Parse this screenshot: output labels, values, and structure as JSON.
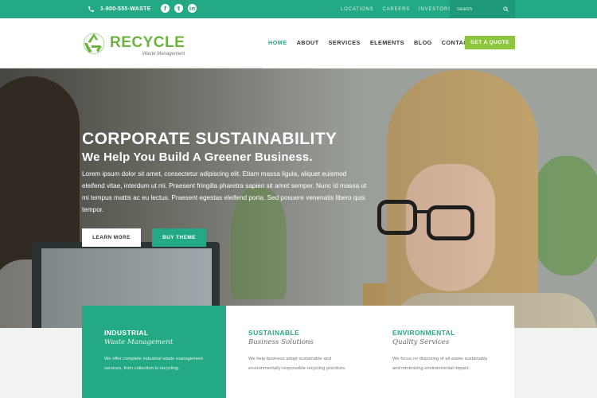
{
  "topbar": {
    "phone": "1-800-555-WASTE",
    "social": [
      "f",
      "t",
      "in"
    ],
    "links": [
      "LOCATIONS",
      "CAREERS",
      "INVESTORS"
    ],
    "search_placeholder": "Search"
  },
  "header": {
    "logo_name": "RECYCLE",
    "logo_sub": "Waste Management",
    "nav": [
      "HOME",
      "ABOUT",
      "SERVICES",
      "ELEMENTS",
      "BLOG",
      "CONTACT"
    ],
    "cta": "GET A QUOTE"
  },
  "hero": {
    "title": "CORPORATE SUSTAINABILITY",
    "subtitle": "We Help You Build A Greener Business.",
    "body": "Lorem ipsum dolor sit amet, consectetur adipiscing elit. Etiam massa ligula, aliquet euismod eleifend vitae, interdum ut mi. Praesent fringilla pharetra sapien sit amet semper. Nunc id massa ut mi tempus mattis ac eu lectus. Praesent egestas eleifend porta. Sed posuere venenatis libero quis tempor.",
    "btn_learn": "LEARN MORE",
    "btn_buy": "BUY THEME"
  },
  "features": [
    {
      "title": "INDUSTRIAL",
      "subtitle": "Waste Management",
      "body": "We offer complete industrial waste management services, from collection to recycling."
    },
    {
      "title": "SUSTAINABLE",
      "subtitle": "Business Solutions",
      "body": "We help business adopt sustainable and environmentally responsible recycling practices."
    },
    {
      "title": "ENVIRONMENTAL",
      "subtitle": "Quality Services",
      "body": "We focus on disposing of all waste sustainably and minimizing environmental impact."
    }
  ],
  "colors": {
    "primary": "#24a985",
    "accent": "#8cc63f",
    "logo": "#6cb33f"
  }
}
